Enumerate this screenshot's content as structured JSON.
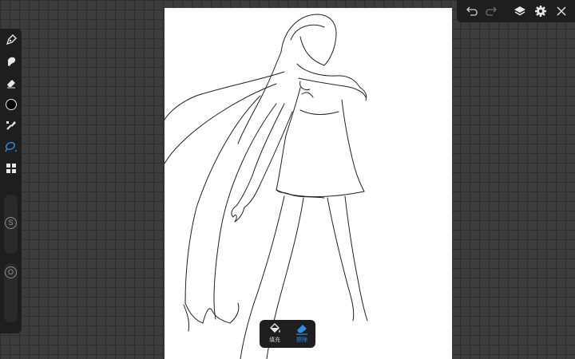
{
  "toolbar_left": {
    "tools": [
      {
        "icon": "pen-icon"
      },
      {
        "icon": "smudge-icon"
      },
      {
        "icon": "eraser-icon"
      },
      {
        "icon": "color-swatch-icon",
        "color": "#000000"
      },
      {
        "icon": "brush-settings-icon"
      },
      {
        "icon": "lasso-icon",
        "active_color": "#2b8fe8"
      },
      {
        "icon": "grid-icon"
      }
    ],
    "size_slider": {
      "label": "S"
    },
    "opacity_slider": {
      "label": "O"
    }
  },
  "top_bar": {
    "buttons": [
      "undo-icon",
      "redo-icon",
      "layers-icon",
      "settings-icon",
      "close-icon"
    ]
  },
  "bottom_bar": {
    "fill": {
      "label": "填充",
      "icon": "paint-bucket-icon"
    },
    "erase": {
      "label": "擦除",
      "icon": "eraser-icon",
      "active": true,
      "color": "#2b8fe8"
    }
  }
}
